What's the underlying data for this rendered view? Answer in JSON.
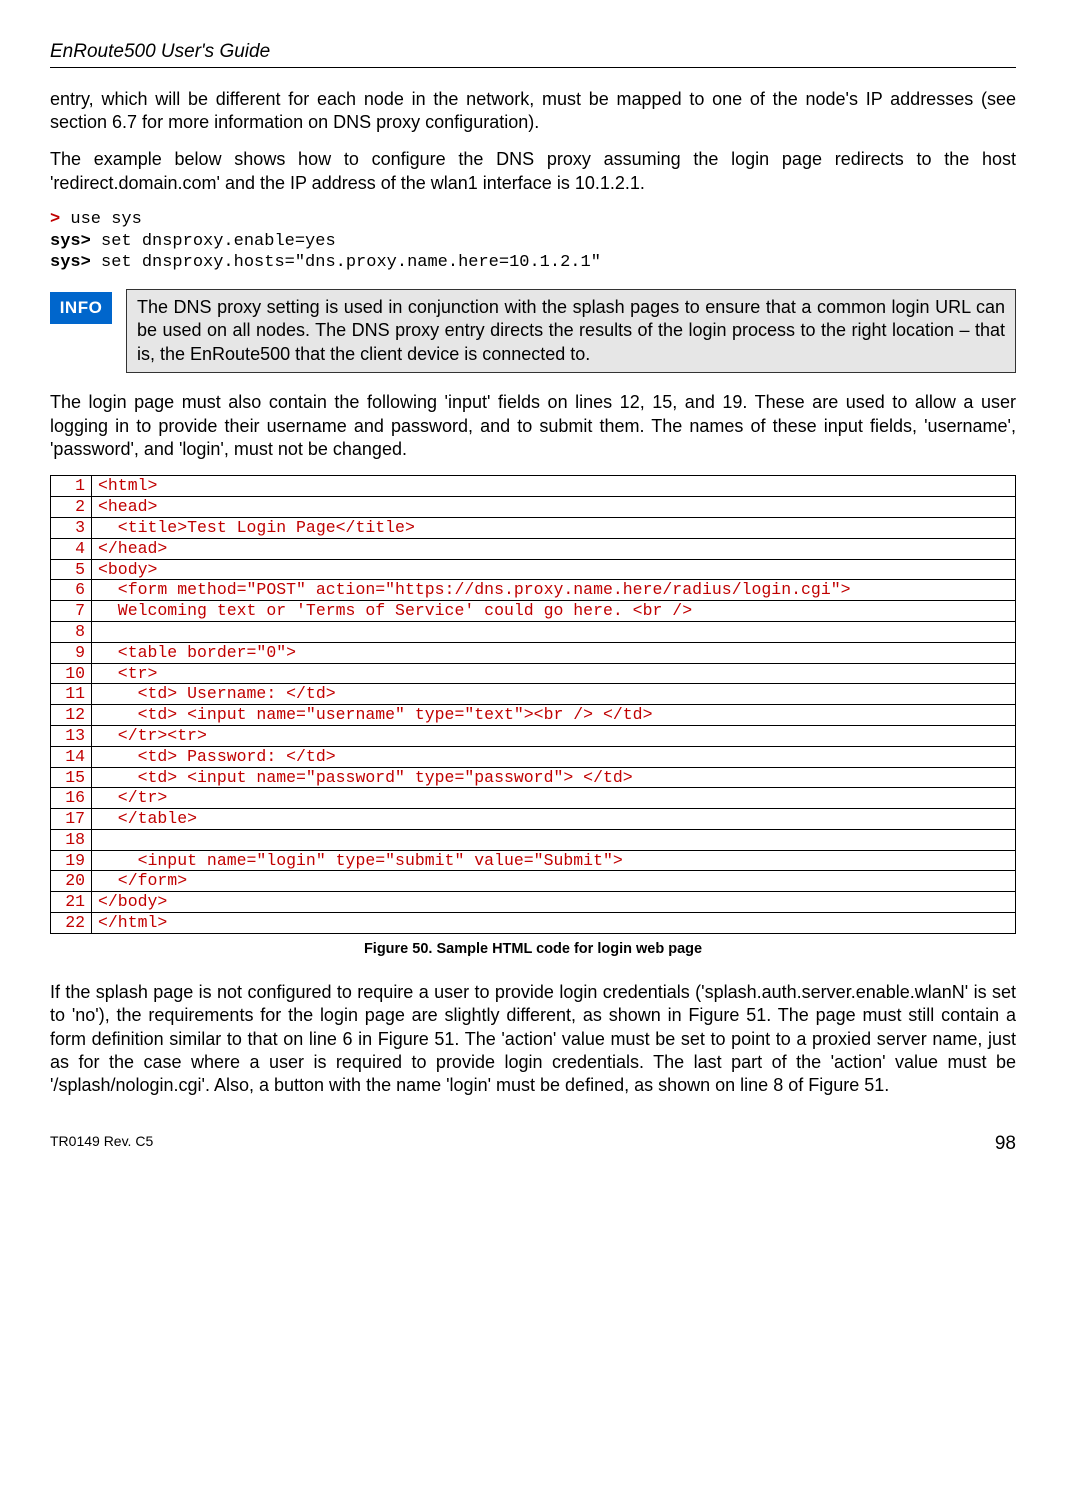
{
  "header": {
    "title": "EnRoute500 User's Guide"
  },
  "para1": "entry, which will be different for each node in the network, must be mapped to one of the node's IP addresses (see section 6.7 for more information on DNS proxy configuration).",
  "para2": "The example below shows how to configure the DNS proxy assuming the login page redirects to the host 'redirect.domain.com' and the IP address of the wlan1 interface is 10.1.2.1.",
  "cli": {
    "l1p": ">",
    "l1c": " use sys",
    "l2p": "sys>",
    "l2c": " set dnsproxy.enable=yes",
    "l3p": "sys>",
    "l3c": " set dnsproxy.hosts=\"dns.proxy.name.here=10.1.2.1\""
  },
  "info": {
    "label": "INFO",
    "text": "The DNS proxy setting is used in conjunction with the splash pages to ensure that a common login URL can be used on all nodes. The DNS proxy entry directs the results of the login process to the right location – that is, the EnRoute500 that the client device is connected to."
  },
  "para3": "The login page must also contain the following 'input' fields on lines 12, 15, and 19. These are used to allow a user logging in to provide their username and password, and to submit them. The names of these input fields, 'username', 'password', and 'login', must not be changed.",
  "code_lines": [
    {
      "n": "1",
      "c": "<html>"
    },
    {
      "n": "2",
      "c": "<head>"
    },
    {
      "n": "3",
      "c": "  <title>Test Login Page</title>"
    },
    {
      "n": "4",
      "c": "</head>"
    },
    {
      "n": "5",
      "c": "<body>"
    },
    {
      "n": "6",
      "c": "  <form method=\"POST\" action=\"https://dns.proxy.name.here/radius/login.cgi\">"
    },
    {
      "n": "7",
      "c": "  Welcoming text or 'Terms of Service' could go here. <br />"
    },
    {
      "n": "8",
      "c": ""
    },
    {
      "n": "9",
      "c": "  <table border=\"0\">"
    },
    {
      "n": "10",
      "c": "  <tr>"
    },
    {
      "n": "11",
      "c": "    <td> Username: </td>"
    },
    {
      "n": "12",
      "c": "    <td> <input name=\"username\" type=\"text\"><br /> </td>"
    },
    {
      "n": "13",
      "c": "  </tr><tr>"
    },
    {
      "n": "14",
      "c": "    <td> Password: </td>"
    },
    {
      "n": "15",
      "c": "    <td> <input name=\"password\" type=\"password\"> </td>"
    },
    {
      "n": "16",
      "c": "  </tr>"
    },
    {
      "n": "17",
      "c": "  </table>"
    },
    {
      "n": "18",
      "c": ""
    },
    {
      "n": "19",
      "c": "    <input name=\"login\" type=\"submit\" value=\"Submit\">"
    },
    {
      "n": "20",
      "c": "  </form>"
    },
    {
      "n": "21",
      "c": "</body>"
    },
    {
      "n": "22",
      "c": "</html>"
    }
  ],
  "figure_caption": "Figure 50. Sample HTML code for login web page",
  "para4": "If the splash page is not configured to require a user to provide login credentials ('splash.auth.server.enable.wlanN' is set to 'no'), the requirements for the login page are slightly different, as shown in Figure 51. The page must still contain a form definition similar to that on line 6 in Figure 51. The 'action' value must be set to point to a proxied server name, just as for the case where a user is required to provide login credentials. The last part of the 'action' value must be '/splash/nologin.cgi'. Also, a button with the name 'login' must be defined, as shown on line 8 of Figure 51.",
  "footer": {
    "left": "TR0149 Rev. C5",
    "right": "98"
  }
}
